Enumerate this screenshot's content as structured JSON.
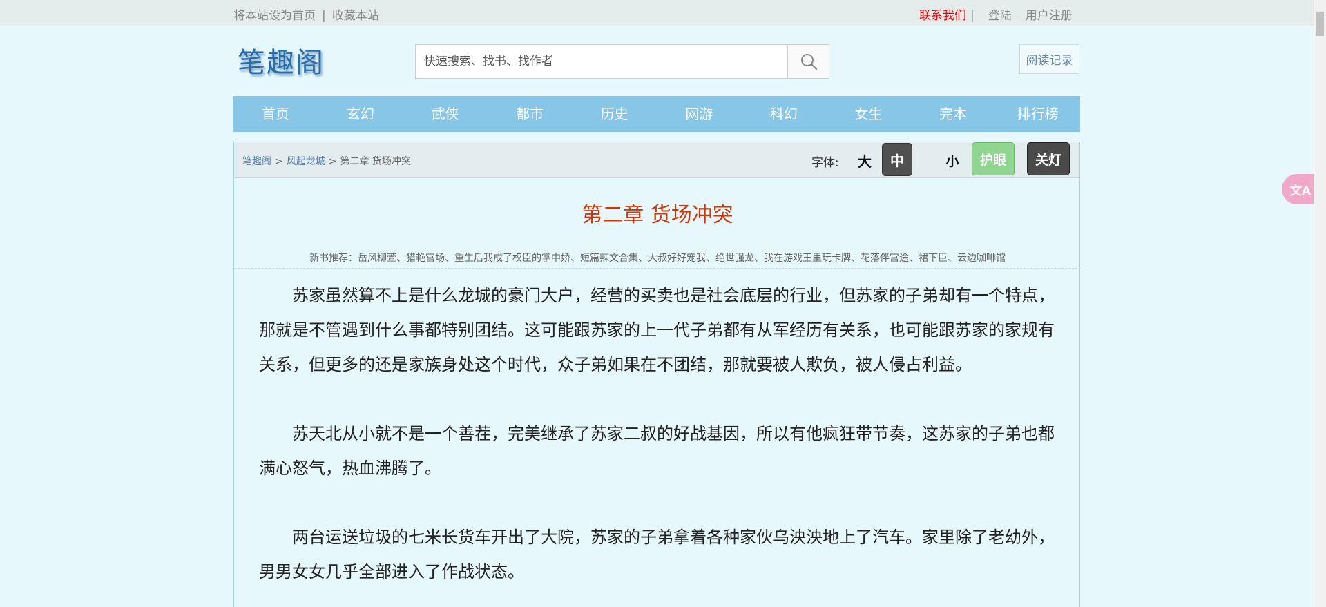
{
  "topbar": {
    "set_home": "将本站设为首页",
    "separator": "|",
    "bookmark": "收藏本站",
    "contact": "联系我们",
    "contact_sep": "|",
    "login": "登陆",
    "register": "用户注册"
  },
  "header": {
    "logo_text": "笔趣阁",
    "search_placeholder": "快速搜索、找书、找作者",
    "history": "阅读记录"
  },
  "nav": {
    "items": [
      "首页",
      "玄幻",
      "武侠",
      "都市",
      "历史",
      "网游",
      "科幻",
      "女生",
      "完本",
      "排行榜"
    ]
  },
  "breadcrumb": {
    "site": "笔趣阁",
    "book": "风起龙城",
    "chapter": "第二章 货场冲突",
    "gt": ">"
  },
  "toolbar": {
    "font_label": "字体:",
    "big": "大",
    "mid": "中",
    "small": "小",
    "eye": "护眼",
    "light": "关灯"
  },
  "chapter": {
    "title": "第二章 货场冲突",
    "recommend": "新书推荐：岳风柳萱、猎艳宫场、重生后我成了权臣的掌中娇、短篇辣文合集、大叔好好宠我、绝世强龙、我在游戏王里玩卡牌、花落伴宫途、裙下臣、云边咖啡馆",
    "paragraphs": [
      "苏家虽然算不上是什么龙城的豪门大户，经营的买卖也是社会底层的行业，但苏家的子弟却有一个特点，那就是不管遇到什么事都特别团结。这可能跟苏家的上一代子弟都有从军经历有关系，也可能跟苏家的家规有关系，但更多的还是家族身处这个时代，众子弟如果在不团结，那就要被人欺负，被人侵占利益。",
      "苏天北从小就不是一个善茬，完美继承了苏家二叔的好战基因，所以有他疯狂带节奏，这苏家的子弟也都满心怒气，热血沸腾了。",
      "两台运送垃圾的七米长货车开出了大院，苏家的子弟拿着各种家伙乌泱泱地上了汽车。家里除了老幼外，男男女女几乎全部进入了作战状态。"
    ]
  },
  "float": {
    "translate_label": "文A"
  }
}
